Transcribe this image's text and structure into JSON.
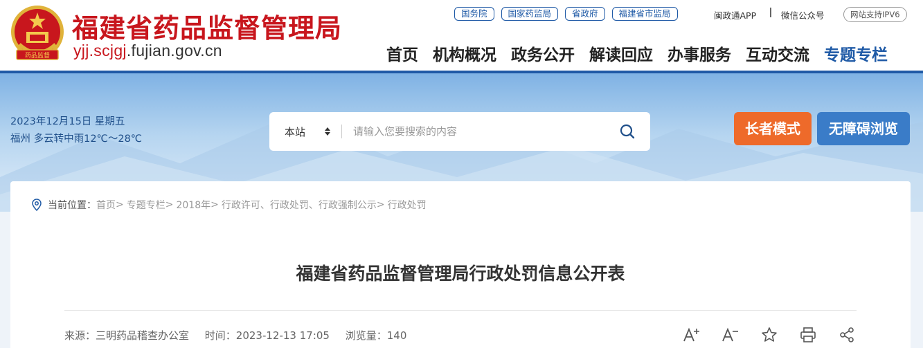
{
  "header": {
    "title": "福建省药品监督管理局",
    "domain_prefix": "yjj.scjgj",
    "domain_suffix": ".fujian.gov.cn",
    "emblem_text": "药品监督"
  },
  "toplinks": {
    "pills": [
      "国务院",
      "国家药监局",
      "省政府",
      "福建省市监局"
    ],
    "app": "闽政通APP",
    "wechat": "微信公众号",
    "ipv6": "网站支持IPV6"
  },
  "nav": [
    "首页",
    "机构概况",
    "政务公开",
    "解读回应",
    "办事服务",
    "互动交流",
    "专题专栏"
  ],
  "banner": {
    "date": "2023年12月15日 星期五",
    "weather": "福州 多云转中雨12℃～28℃",
    "search": {
      "scope": "本站",
      "placeholder": "请输入您要搜索的内容"
    },
    "elder_mode": "长者模式",
    "accessibility": "无障碍浏览"
  },
  "breadcrumb": {
    "label": "当前位置：",
    "items": [
      "首页",
      "专题专栏",
      "2018年",
      "行政许可、行政处罚、行政强制公示",
      "行政处罚"
    ]
  },
  "article": {
    "title": "福建省药品监督管理局行政处罚信息公开表",
    "source": "来源：三明药品稽查办公室",
    "time": "时间：2023-12-13 17:05",
    "views": "浏览量：140"
  },
  "colors": {
    "brand_red": "#c8161d",
    "brand_blue": "#1f5aa6",
    "elder_orange": "#ee6a2a",
    "access_blue": "#3a7cc8"
  },
  "icons": [
    "font-increase-icon",
    "font-decrease-icon",
    "star-icon",
    "print-icon",
    "share-icon"
  ]
}
